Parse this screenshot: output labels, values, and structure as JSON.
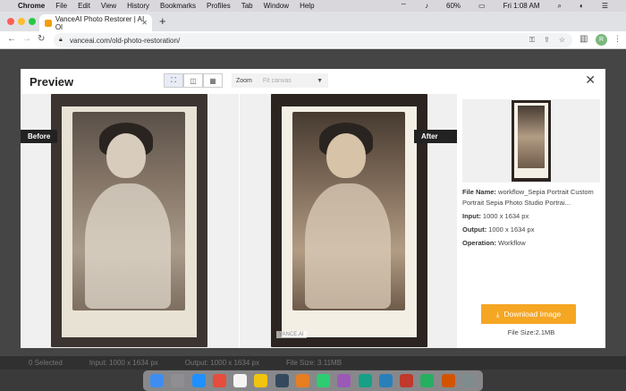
{
  "menubar": {
    "apple": "",
    "app_name": "Chrome",
    "items": [
      "File",
      "Edit",
      "View",
      "History",
      "Bookmarks",
      "Profiles",
      "Tab",
      "Window",
      "Help"
    ],
    "battery": "60%",
    "clock": "Fri 1:08 AM"
  },
  "browser": {
    "tab_title": "VanceAI Photo Restorer | AI Ol",
    "url": "vanceai.com/old-photo-restoration/",
    "account_initial": "R"
  },
  "page": {
    "bottom_bar": {
      "selected": "0  Selected",
      "input": "Input: 1000 x 1634 px",
      "output": "Output: 1000 x 1634 px",
      "file_size": "File Size: 3.11MB"
    }
  },
  "modal": {
    "title": "Preview",
    "view_modes": [
      "fit-icon",
      "split-icon",
      "grid-icon"
    ],
    "zoom_label": "Zoom",
    "zoom_value": "Fit canvas",
    "before_label": "Before",
    "after_label": "After",
    "watermark": "VANCE.AI",
    "info": {
      "file_name_key": "File Name:",
      "file_name_value": "workflow_Sepia Portrait Custom Portrait Sepia Photo Studio Portrai...",
      "input_key": "Input:",
      "input_value": "1000 x 1634 px",
      "output_key": "Output:",
      "output_value": "1000 x 1634 px",
      "operation_key": "Operation:",
      "operation_value": "Workflow"
    },
    "download_label": "Download Image",
    "file_size": "File Size:2.1MB"
  },
  "colors": {
    "accent": "#f5a623",
    "label_bg": "#222222"
  }
}
